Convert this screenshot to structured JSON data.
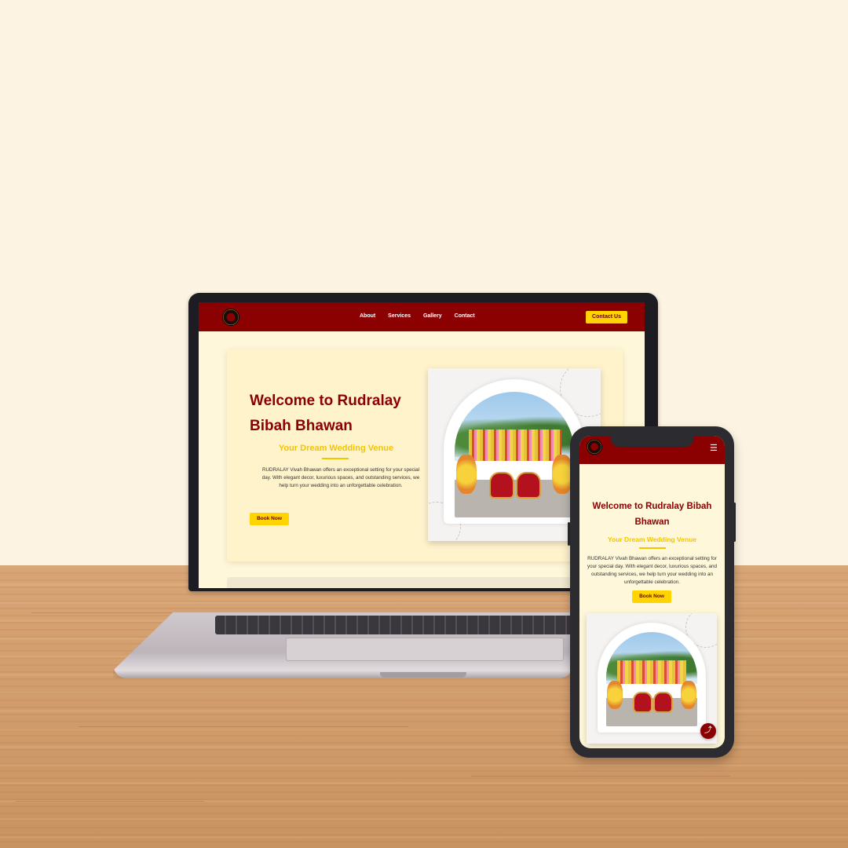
{
  "laptop": {
    "nav": {
      "links": [
        "About",
        "Services",
        "Gallery",
        "Contact"
      ],
      "cta": "Contact Us"
    },
    "hero": {
      "title_line1": "Welcome to Rudralay",
      "title_line2": "Bibah Bhawan",
      "subtitle": "Your Dream Wedding Venue",
      "description": "RUDRALAY Vivah Bhawan offers an exceptional setting for your special day. With elegant decor, luxurious spaces, and outstanding services, we help turn your wedding into an unforgettable celebration.",
      "button": "Book Now"
    }
  },
  "phone": {
    "menu_icon": "☰",
    "hero": {
      "title": "Welcome to Rudralay Bibah Bhawan",
      "subtitle": "Your Dream Wedding Venue",
      "description": "RUDRALAY Vivah Bhawan offers an exceptional setting for your special day. With elegant decor, luxurious spaces, and outstanding services, we help turn your wedding into an unforgettable celebration.",
      "button": "Book Now"
    },
    "share_icon": "⤴"
  },
  "icons": [
    "logo-icon",
    "hamburger-icon",
    "share-icon"
  ],
  "colors": {
    "primary": "#8b0000",
    "accent": "#ffd400",
    "page_bg": "#fff7d9",
    "backdrop": "#fdf3e2"
  }
}
